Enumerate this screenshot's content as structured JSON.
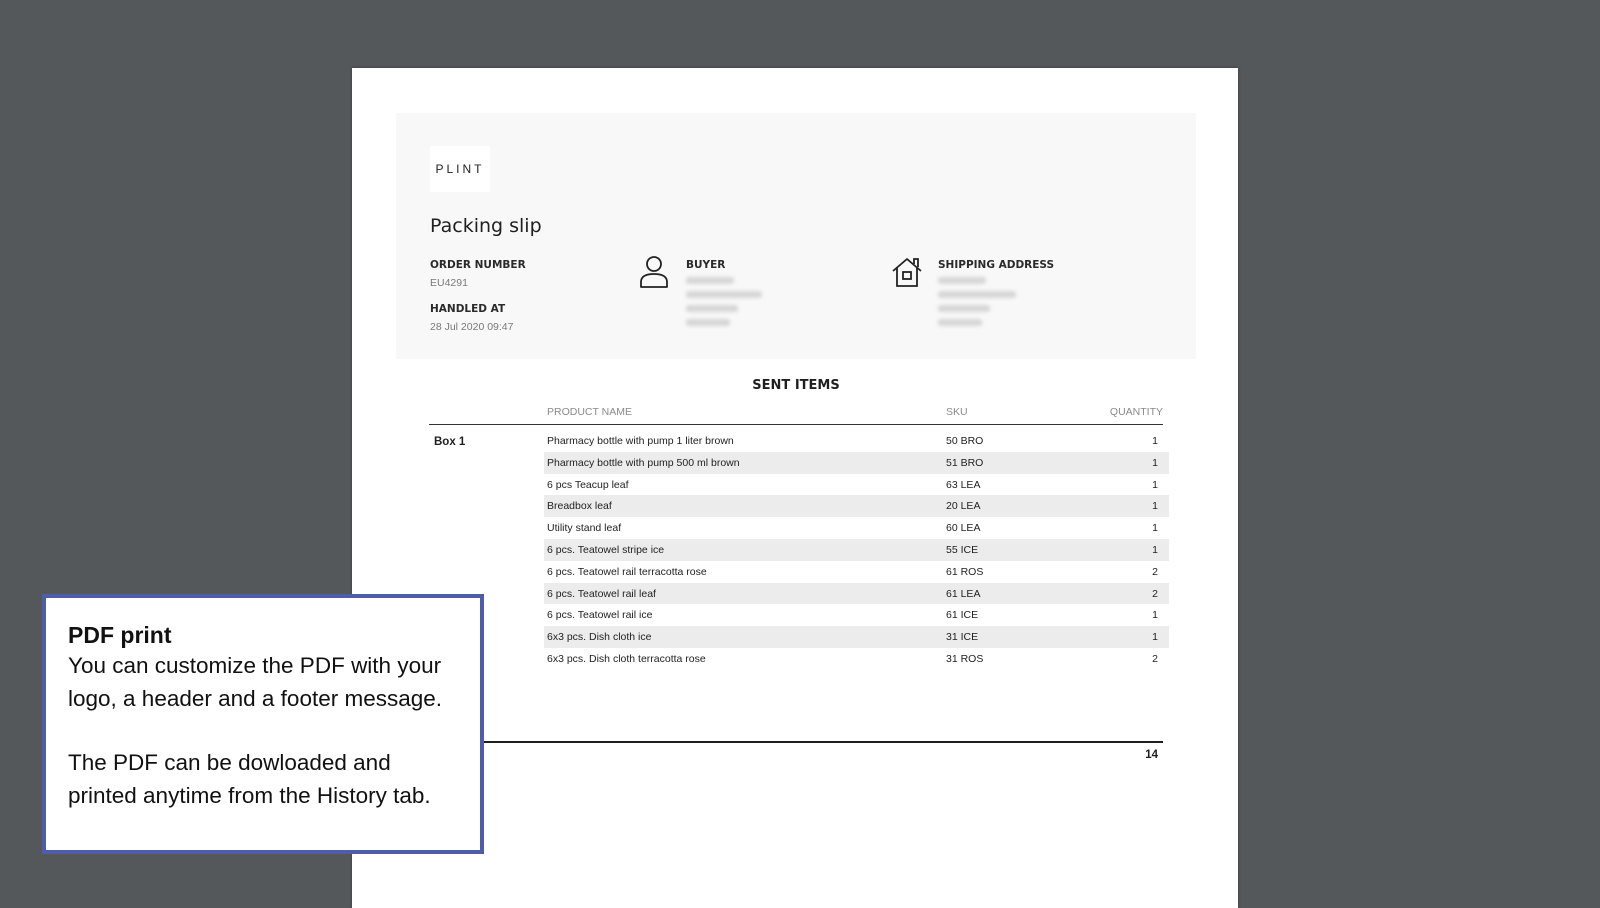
{
  "document": {
    "logo_text": "PLINT",
    "title": "Packing slip",
    "order_number_label": "ORDER NUMBER",
    "order_number": "EU4291",
    "handled_at_label": "HANDLED AT",
    "handled_at": "28 Jul 2020 09:47",
    "buyer_label": "BUYER",
    "shipping_label": "SHIPPING ADDRESS",
    "icons": {
      "buyer": "person-icon",
      "shipping": "house-icon"
    }
  },
  "sent_items": {
    "title": "SENT ITEMS",
    "headers": {
      "product": "PRODUCT NAME",
      "sku": "SKU",
      "quantity": "QUANTITY"
    },
    "box_label": "Box 1",
    "rows": [
      {
        "product": "Pharmacy bottle with pump 1 liter brown",
        "sku": "50 BRO",
        "qty": "1"
      },
      {
        "product": "Pharmacy bottle with pump 500 ml brown",
        "sku": "51 BRO",
        "qty": "1"
      },
      {
        "product": "6 pcs Teacup leaf",
        "sku": "63 LEA",
        "qty": "1"
      },
      {
        "product": "Breadbox leaf",
        "sku": "20 LEA",
        "qty": "1"
      },
      {
        "product": "Utility stand leaf",
        "sku": "60 LEA",
        "qty": "1"
      },
      {
        "product": "6 pcs. Teatowel stripe ice",
        "sku": "55 ICE",
        "qty": "1"
      },
      {
        "product": "6 pcs. Teatowel rail terracotta rose",
        "sku": "61 ROS",
        "qty": "2"
      },
      {
        "product": "6 pcs. Teatowel rail leaf",
        "sku": "61 LEA",
        "qty": "2"
      },
      {
        "product": "6 pcs. Teatowel rail ice",
        "sku": "61 ICE",
        "qty": "1"
      },
      {
        "product": "6x3 pcs. Dish cloth ice",
        "sku": "31 ICE",
        "qty": "1"
      },
      {
        "product": "6x3 pcs. Dish cloth terracotta rose",
        "sku": "31 ROS",
        "qty": "2"
      }
    ],
    "total_quantity": "14"
  },
  "callout": {
    "title": "PDF print",
    "text1": "You can customize the PDF with your logo, a header and a footer message.",
    "text2": "The PDF can be dowloaded and printed anytime from the History tab."
  },
  "colors": {
    "background": "#54585a",
    "callout_border": "#4f5da8",
    "header_panel": "#f8f8f8",
    "row_stripe": "#ececec"
  }
}
